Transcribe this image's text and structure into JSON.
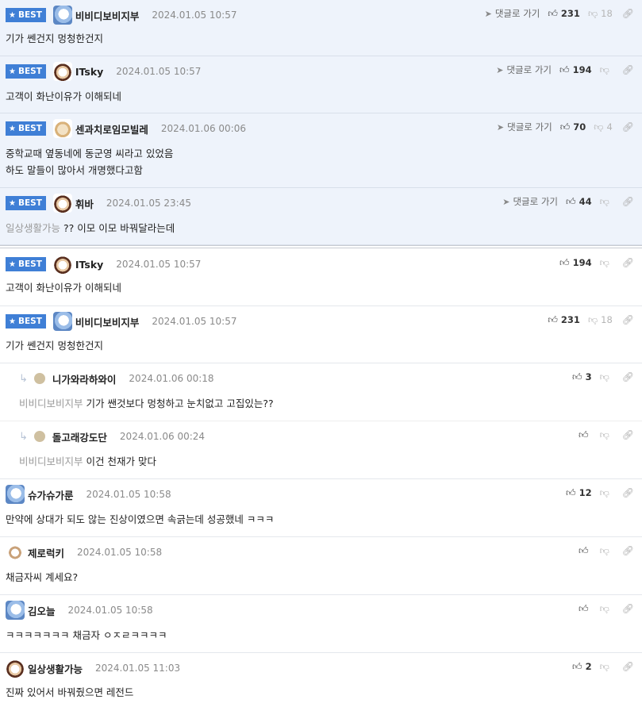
{
  "labels": {
    "best": "BEST",
    "reply": "댓글로 가기"
  },
  "icons": {
    "best_star": "star-icon",
    "thumb_up": "thumb-up-icon",
    "thumb_down": "thumb-down-icon",
    "share": "share-icon",
    "reply_arrow": "reply-arrow-icon"
  },
  "colors": {
    "best_bg": "#eef3fb",
    "badge": "#3f7fd6"
  },
  "top_best": [
    {
      "nick": "비비디보비지부",
      "date": "2024.01.05 10:57",
      "text": "기가 쎈건지 멍청한건지",
      "likes": "231",
      "dislikes": "18"
    },
    {
      "nick": "ITsky",
      "date": "2024.01.05 10:57",
      "text": "고객이 화난이유가 이해되네",
      "likes": "194",
      "dislikes": ""
    },
    {
      "nick": "센과치로임모빌레",
      "date": "2024.01.06 00:06",
      "text1": "중학교때 옆동네에 동군영 씨라고 있었음",
      "text2": "하도 말들이 많아서 개명했다고함",
      "likes": "70",
      "dislikes": "4"
    },
    {
      "nick": "휘바",
      "date": "2024.01.05 23:45",
      "mention": "일상생활가능",
      "text": "?? 이모 이모 바꿔달라는데",
      "likes": "44",
      "dislikes": ""
    }
  ],
  "list": [
    {
      "nick": "ITsky",
      "date": "2024.01.05 10:57",
      "text": "고객이 화난이유가 이해되네",
      "likes": "194",
      "dislikes": ""
    },
    {
      "nick": "비비디보비지부",
      "date": "2024.01.05 10:57",
      "text": "기가 쎈건지 멍청한건지",
      "likes": "231",
      "dislikes": "18"
    },
    {
      "nick": "니가와라하와이",
      "date": "2024.01.06 00:18",
      "mention": "비비디보비지부",
      "text": "기가 쌘것보다 멍청하고 눈치없고 고집있는??",
      "likes": "3",
      "dislikes": ""
    },
    {
      "nick": "돌고래강도단",
      "date": "2024.01.06 00:24",
      "mention": "비비디보비지부",
      "text": "이건 천재가 맞다",
      "likes": "",
      "dislikes": ""
    },
    {
      "nick": "슈가슈가룬",
      "date": "2024.01.05 10:58",
      "text": "만약에 상대가 되도 않는 진상이였으면 속긁는데 성공했네 ㅋㅋㅋ",
      "likes": "12",
      "dislikes": ""
    },
    {
      "nick": "제로럭키",
      "date": "2024.01.05 10:58",
      "text": "채금자씨 계세요?",
      "likes": "",
      "dislikes": ""
    },
    {
      "nick": "김오늘",
      "date": "2024.01.05 10:58",
      "text": "ㅋㅋㅋㅋㅋㅋㅋ 채금자 ㅇㅈㄹㅋㅋㅋㅋ",
      "likes": "",
      "dislikes": ""
    },
    {
      "nick": "일상생활가능",
      "date": "2024.01.05 11:03",
      "text": "진짜 있어서 바꿔줬으면 레전드",
      "likes": "2",
      "dislikes": ""
    }
  ]
}
